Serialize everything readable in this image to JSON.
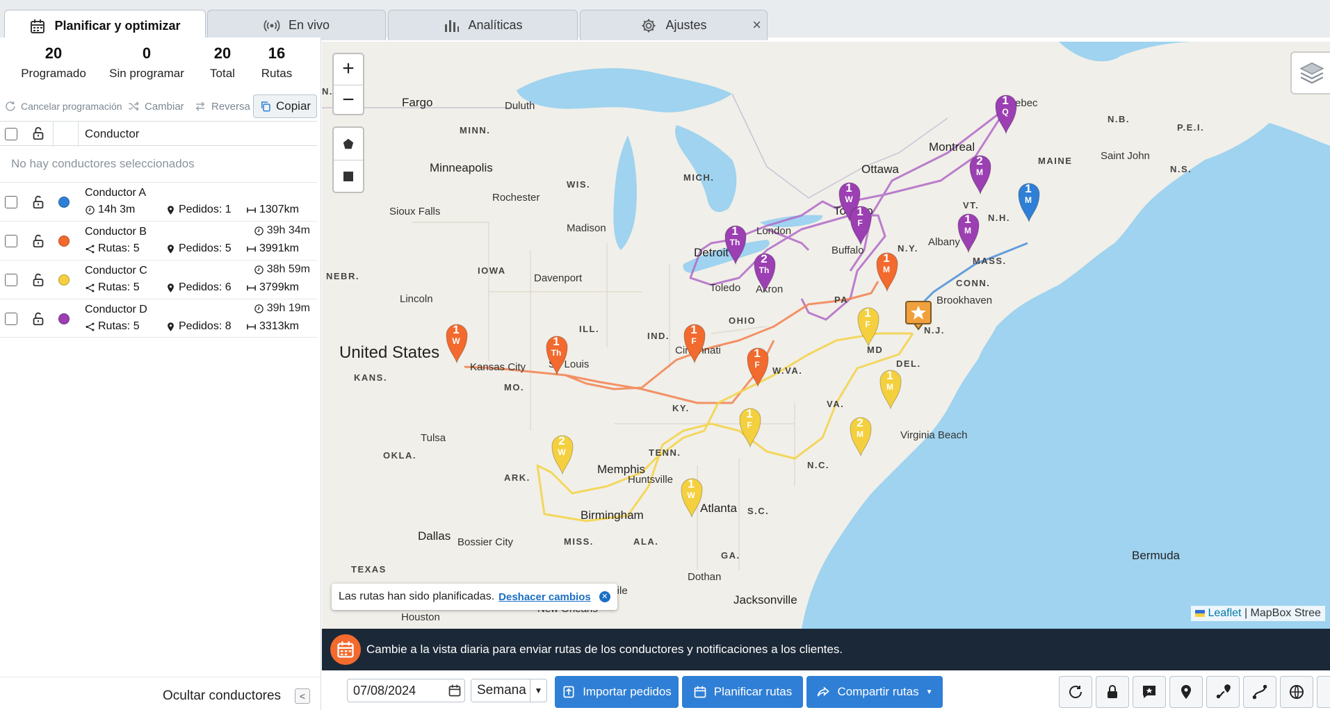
{
  "tabs": [
    {
      "label": "Planificar y optimizar",
      "icon": "calendar-icon",
      "active": true
    },
    {
      "label": "En vivo",
      "icon": "broadcast-icon"
    },
    {
      "label": "Analíticas",
      "icon": "bar-chart-icon"
    },
    {
      "label": "Ajustes",
      "icon": "gear-icon",
      "close": "×"
    }
  ],
  "stats": [
    {
      "value": "20",
      "label": "Programado"
    },
    {
      "value": "0",
      "label": "Sin programar"
    },
    {
      "value": "20",
      "label": "Total"
    },
    {
      "value": "16",
      "label": "Rutas"
    }
  ],
  "toolbar": {
    "cancel": "Cancelar programación",
    "change": "Cambiar",
    "reverse": "Reversa",
    "copy": "Copiar"
  },
  "table": {
    "column_driver": "Conductor",
    "empty_note": "No hay conductores seleccionados"
  },
  "drivers": [
    {
      "name": "Conductor A",
      "color": "#2f7fd6",
      "duration": "14h 3m",
      "routes": "",
      "orders": "Pedidos: 1",
      "distance": "1307km"
    },
    {
      "name": "Conductor B",
      "color": "#f26a2e",
      "duration": "39h 34m",
      "routes": "Rutas: 5",
      "orders": "Pedidos: 5",
      "distance": "3991km"
    },
    {
      "name": "Conductor C",
      "color": "#f4d03f",
      "duration": "38h 59m",
      "routes": "Rutas: 5",
      "orders": "Pedidos: 6",
      "distance": "3799km"
    },
    {
      "name": "Conductor D",
      "color": "#9b3fb3",
      "duration": "39h 19m",
      "routes": "Rutas: 5",
      "orders": "Pedidos: 8",
      "distance": "3313km"
    }
  ],
  "hide_drivers": "Ocultar conductores",
  "map": {
    "zoom_in": "+",
    "zoom_out": "−",
    "toast_text": "Las rutas han sido planificadas.",
    "toast_undo": "Deshacer cambios",
    "attrib_leaflet": "Leaflet",
    "attrib_rest": " | MapBox Stree",
    "labels": {
      "fargo": "Fargo",
      "duluth": "Duluth",
      "minn": "MINN.",
      "minneapolis": "Minneapolis",
      "wis": "WIS.",
      "mich": "MICH.",
      "rochester": "Rochester",
      "siouxfalls": "Sioux Falls",
      "madison": "Madison",
      "iowa": "IOWA",
      "davenport": "Davenport",
      "nebr": "NEBR.",
      "lincoln": "Lincoln",
      "ill": "ILL.",
      "ind": "IND.",
      "ohio": "OHIO",
      "pa": "PA",
      "ny": "N.Y.",
      "vt": "VT.",
      "nh": "N.H.",
      "mass": "MASS.",
      "conn": "CONN.",
      "maine": "MAINE",
      "nb": "N.B.",
      "pei": "P.E.I.",
      "ns": "N.S.",
      "saintjohn": "Saint John",
      "quebec": "Quebec",
      "montreal": "Montreal",
      "ottawa": "Ottawa",
      "toronto": "Toronto",
      "london": "London",
      "detroit": "Detroit",
      "toledo": "Toledo",
      "akron": "Akron",
      "buffalo": "Buffalo",
      "albany": "Albany",
      "brookhaven": "Brookhaven",
      "nj": "N.J.",
      "del": "DEL.",
      "md": "MD",
      "wva": "W.VA.",
      "va": "VA.",
      "nc": "N.C.",
      "sc": "S.C.",
      "ga": "GA.",
      "ala": "ALA.",
      "miss": "MISS.",
      "tenn": "TENN.",
      "ky": "KY.",
      "mo": "MO.",
      "kans": "KANS.",
      "okla": "OKLA.",
      "ark": "ARK.",
      "texas": "TEXAS",
      "us": "United States",
      "kansascity": "Kansas City",
      "stlouis": "St. Louis",
      "cincinnati": "Cincinnati",
      "tulsa": "Tulsa",
      "memphis": "Memphis",
      "huntsville": "Huntsville",
      "birmingham": "Birmingham",
      "atlanta": "Atlanta",
      "dallas": "Dallas",
      "bossier": "Bossier City",
      "houston": "Houston",
      "mobile": "obile",
      "dothan": "Dothan",
      "jacksonville": "Jacksonville",
      "neworleans": "New Orleans",
      "virginiabeach": "Virginia Beach",
      "bermuda": "Bermuda",
      "n_edge": "N."
    },
    "pins": [
      {
        "num": "1",
        "day": "Q",
        "color": "#9b3fb3"
      },
      {
        "num": "2",
        "day": "M",
        "color": "#9b3fb3"
      },
      {
        "num": "1",
        "day": "M",
        "color": "#2f7fd6"
      },
      {
        "num": "1",
        "day": "W",
        "color": "#9b3fb3"
      },
      {
        "num": "1",
        "day": "F",
        "color": "#9b3fb3"
      },
      {
        "num": "1",
        "day": "M",
        "color": "#9b3fb3"
      },
      {
        "num": "1",
        "day": "Th",
        "color": "#9b3fb3"
      },
      {
        "num": "2",
        "day": "Th",
        "color": "#9b3fb3"
      },
      {
        "num": "1",
        "day": "M",
        "color": "#f26a2e"
      },
      {
        "num": "1",
        "day": "W",
        "color": "#f26a2e"
      },
      {
        "num": "1",
        "day": "Th",
        "color": "#f26a2e"
      },
      {
        "num": "1",
        "day": "F",
        "color": "#f26a2e"
      },
      {
        "num": "1",
        "day": "F",
        "color": "#f26a2e"
      },
      {
        "num": "1",
        "day": "F",
        "color": "#f4d03f"
      },
      {
        "num": "1",
        "day": "M",
        "color": "#f4d03f"
      },
      {
        "num": "1",
        "day": "F",
        "color": "#f4d03f"
      },
      {
        "num": "2",
        "day": "M",
        "color": "#f4d03f"
      },
      {
        "num": "2",
        "day": "W",
        "color": "#f4d03f"
      },
      {
        "num": "1",
        "day": "W",
        "color": "#f4d03f"
      }
    ]
  },
  "banner": "Cambie a la vista diaria para enviar rutas de los conductores y notificaciones a los clientes.",
  "bottom": {
    "date": "07/08/2024",
    "period": "Semana",
    "import": "Importar pedidos",
    "plan": "Planificar rutas",
    "share": "Compartir rutas"
  }
}
